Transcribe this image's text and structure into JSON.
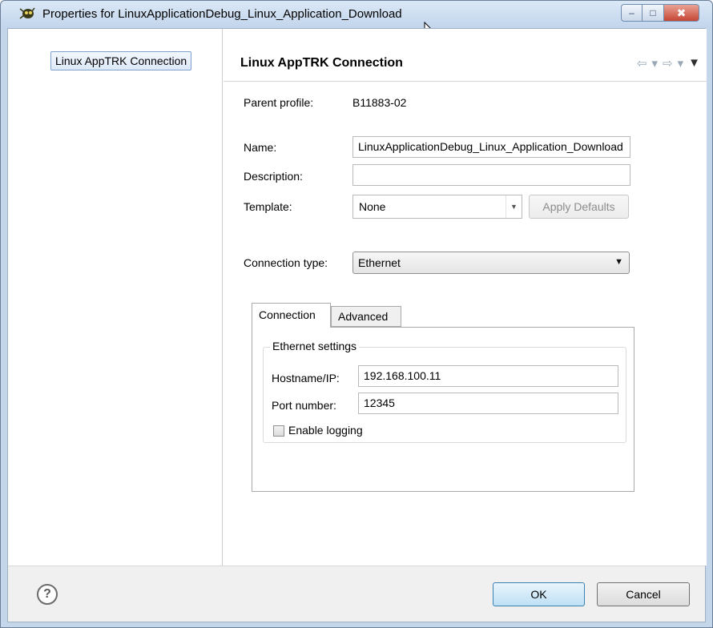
{
  "window": {
    "title": "Properties for LinuxApplicationDebug_Linux_Application_Download",
    "minimize_glyph": "–",
    "maximize_glyph": "□",
    "close_glyph": "✖"
  },
  "nav": {
    "items": [
      {
        "label": "Linux AppTRK Connection"
      }
    ]
  },
  "page": {
    "title": "Linux AppTRK Connection",
    "history": {
      "back": "⇦",
      "dropdown": "▾",
      "forward": "⇨",
      "menu": "▼"
    }
  },
  "form": {
    "parent_profile_label": "Parent profile:",
    "parent_profile_value": "B11883-02",
    "name_label": "Name:",
    "name_value": "LinuxApplicationDebug_Linux_Application_Download",
    "description_label": "Description:",
    "description_value": "",
    "template_label": "Template:",
    "template_value": "None",
    "apply_defaults_label": "Apply Defaults",
    "connection_type_label": "Connection type:",
    "connection_type_value": "Ethernet"
  },
  "tabs": [
    {
      "label": "Connection",
      "active": true
    },
    {
      "label": "Advanced",
      "active": false
    }
  ],
  "ethernet": {
    "group_title": "Ethernet settings",
    "hostname_label": "Hostname/IP:",
    "hostname_value": "192.168.100.11",
    "port_label": "Port number:",
    "port_value": "12345",
    "logging_label": "Enable logging",
    "logging_checked": false
  },
  "footer": {
    "help_glyph": "?",
    "ok_label": "OK",
    "cancel_label": "Cancel"
  },
  "colors": {
    "title_bar": "#c2d5ec",
    "close_button": "#c64634",
    "selection_border": "#7da2ce",
    "default_button_border": "#3c7fb1"
  }
}
